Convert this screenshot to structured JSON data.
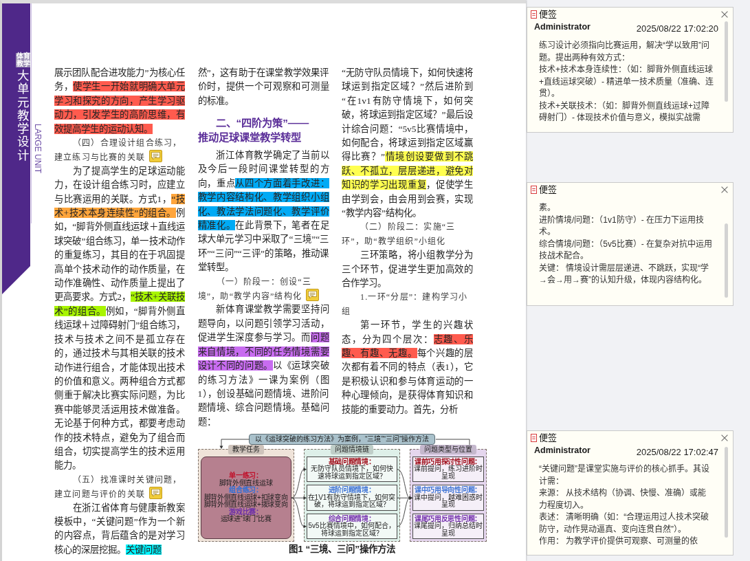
{
  "sidebar": {
    "tag": "体育教学",
    "title": "大单元教学设计",
    "subtitle": "LARGE UNIT"
  },
  "columns": [
    {
      "blocks": [
        {
          "kind": "continuation",
          "segments": [
            {
              "text": "展示团队配合进攻能力”为核心任务，"
            },
            {
              "text": "使学生一开始就明确大单元学习和探究的方向，产生学习驱动力，引发学生的高阶思维，有效提高学生的运动认知。",
              "color": "#ff5b4e"
            }
          ]
        },
        {
          "kind": "subheading",
          "text": "（四）合理设计组合练习，建立练习与比赛的关联",
          "comment": true
        },
        {
          "kind": "paragraph",
          "segments": [
            {
              "text": "为了提高学生的足球运动能力，在设计组合练习时，应建立与比赛运用的关联。方式1，"
            },
            {
              "text": "“技术+技术本身连续性”的组合。",
              "color": "#ffa53c"
            },
            {
              "text": "例如，“脚背外侧直线运球＋直线运球突破”组合练习，单一技术动作的重复练习，其目的在于巩固提高单个技术动作的动作质量，在动作准确性、动作质量上提出了更高要求。方式2，"
            },
            {
              "text": "“技术+关联技术”的组合。",
              "color": "#a8f500"
            },
            {
              "text": "例如，“脚背外侧直线运球＋过障碍射门”组合练习，技术与技术之间不是孤立存在的，通过技术与其相关联的技术动作进行组合，才能体现出技术的价值和意义。两种组合方式都侧重于解决比赛实际问题，为比赛中能够灵活运用技术做准备。无论基于何种方式，都要考虑动作的技术特点，避免为了组合而组合，切实提高学生的技术运用能力。"
            }
          ]
        },
        {
          "kind": "subheading",
          "text": "（五）找准课时关键问题，建立问题与评价的关联",
          "comment": true
        },
        {
          "kind": "paragraph",
          "segments": [
            {
              "text": "在浙江省体育与健康新教案模板中，“关键问题”作为一个新的内容点，背后蕴含的是对学习核心的深层挖掘。"
            },
            {
              "text": "关键问题",
              "color": "#00f5ff"
            }
          ]
        }
      ]
    },
    {
      "blocks": [
        {
          "kind": "continuation",
          "segments": [
            {
              "text": "然”，这有助于在课堂教学效果评价时，提供一个可观察和可测量的标准。"
            }
          ]
        },
        {
          "kind": "section_heading",
          "lines": [
            "二、“四阶为策”——",
            "推动足球课堂教学转型"
          ]
        },
        {
          "kind": "paragraph",
          "segments": [
            {
              "text": "浙江体育教学确定了当前以及今后一段时间课堂转型的方向，重点"
            },
            {
              "text": "从四个方面着手改进：教学内容结构化、教学组织小组化、教法学法问题化、教学评价精准化。",
              "color": "#00aaf5"
            },
            {
              "text": "在此背景下，笔者在足球大单元学习中采取了“三境”“三环”“三问”“三评”的策略，推动课堂转型。"
            }
          ]
        },
        {
          "kind": "subheading",
          "text": "（一）阶段一：创设“三境”，助“教学内容”结构化",
          "comment": true
        },
        {
          "kind": "paragraph",
          "segments": [
            {
              "text": "新体育课堂教学需要坚持问题导向，以问题引领学习活动，促进学生深度参与学习。而"
            },
            {
              "text": "问题来自情境，不同的任务情境需要设计不同的问题。",
              "color": "#c86cf0"
            },
            {
              "text": "以《运球突破的练习方法》一课为案例（图1），创设基础问题情境、进阶问题情境、综合问题情境。基础问题："
            }
          ]
        }
      ]
    },
    {
      "blocks": [
        {
          "kind": "continuation",
          "segments": [
            {
              "text": "“无防守队员情境下，如何快速将球运到指定区域？”然后进阶到“在1v1有防守情境下，如何突破，将球运到指定区域？”最后设计综合问题：“5v5比赛情境中，如何配合，将球运到指定区域赢得比赛？”"
            },
            {
              "text": "情境创设要做到不跳跃、不孤立，层层递进，避免对知识的学习出现重复",
              "color": "#ffff50"
            },
            {
              "text": "，促使学生由学到会，由会用到会赛，实现“教学内容”结构化。"
            }
          ]
        },
        {
          "kind": "subheading",
          "text": "（二）阶段二：实施“三环”，助“教学组织”小组化",
          "comment": false
        },
        {
          "kind": "paragraph",
          "segments": [
            {
              "text": "三环策略，将小组教学分为三个环节，促进学生更加高效的合作学习。"
            }
          ]
        },
        {
          "kind": "subheading",
          "text": "1.一环“分层”：建构学习小组",
          "comment": false
        },
        {
          "kind": "paragraph",
          "segments": [
            {
              "text": "第一环节，学生的兴趣状态，分为四个层次："
            },
            {
              "text": "志趣、乐趣、有趣、无趣。",
              "color": "#ff5b4e"
            },
            {
              "text": "每个兴趣的层次都有着不同的特点（表1），它是积极认识和参与体育运动的一种心理倾向，是获得体育知识和技能的重要动力。首先，分析"
            }
          ]
        }
      ]
    }
  ],
  "figure": {
    "banner": "以《运球突破的练习方法》为案例，“三境”“三问”操作方法",
    "panels": [
      {
        "kind": "grouped",
        "tag": "教学任务",
        "color": "#efe3d9",
        "items": [
          {
            "title": "单一练习：",
            "color": "#c0102a",
            "lines": [
              "脚背外侧直线运球"
            ]
          },
          {
            "title": "组合练习：",
            "color": "#2f6fd6",
            "lines": [
              "脚背外侧直线运球+扣球变向",
              "脚背外侧直线运球+拨球变向"
            ]
          },
          {
            "title": "游戏比赛：",
            "color": "#6b2fa8",
            "lines": [
              "运球进“球门”比赛"
            ]
          }
        ]
      },
      {
        "kind": "boxed",
        "tag": "问题情境链",
        "color": "#def0e9",
        "items": [
          {
            "title": "基础问题情境：",
            "color": "#a0101c",
            "lines": [
              "无防守队员情境下，如何快速将球运到指定区域？"
            ]
          },
          {
            "title": "进阶问题情境：",
            "color": "#3f74d4",
            "lines": [
              "在1V1有防守情境下，如何突破，将球运到指定区域？"
            ]
          },
          {
            "title": "综合问题情境：",
            "color": "#7532ad",
            "lines": [
              "5v5比赛情境中，如何配合，将球运到指定区域？"
            ]
          }
        ]
      },
      {
        "kind": "boxed",
        "tag": "问题类型与位置",
        "color": "#e5d6ee",
        "items": [
          {
            "title": "课前巧用探讨性问题：",
            "color": "#a0101c",
            "lines": [
              "课前提问，练习进阶时呈现"
            ]
          },
          {
            "title": "课中巧用导向性问题：",
            "color": "#3f74d4",
            "lines": [
              "课中提问，越难困惑时呈现"
            ]
          },
          {
            "title": "课尾巧用反思性问题：",
            "color": "#7532ad",
            "lines": [
              "课尾提问，归纳总结时呈现"
            ]
          }
        ]
      }
    ],
    "caption": "图1 “三境、三问”操作方法"
  },
  "notes": [
    {
      "title": "便签",
      "author": "Administrator",
      "date": "2025/08/22 17:02:20",
      "paragraphs": [
        "练习设计必须指向比赛运用，解决“学以致用”问题。提出两种有效方式：",
        "技术+技术本身连续性：（如：脚背外侧直线运球+直线运球突破）- 精进单一技术质量（准确、连贯）。",
        "技术+关联技术：（如：脚背外侧直线运球+过障碍射门）- 体现技术价值与意义，模拟实战需"
      ]
    },
    {
      "title": "便签",
      "paragraphs": [
        "素。",
        "进阶情境/问题：（1v1防守）- 在压力下运用技术。",
        "综合情境/问题：（5v5比赛）- 在复杂对抗中运用技战术配合。",
        "关键： 情境设计需层层递进、不跳跃，实现“学→会→用→赛”的认知升级，体现内容结构化。"
      ]
    },
    {
      "title": "便签",
      "author": "Administrator",
      "date": "2025/08/22 17:02:47",
      "paragraphs": [
        "“关键问题”是课堂实施与评价的核心抓手。其设计需：",
        "来源： 从技术结构（协调、快慢、准确）或能力程度切入。",
        "表述： 清晰明确（如：“合理运用过人技术突破防守，动作晃动逼真、变向连贯自然”）。",
        "作用： 为教学评价提供可观察、可测量的依"
      ]
    }
  ]
}
